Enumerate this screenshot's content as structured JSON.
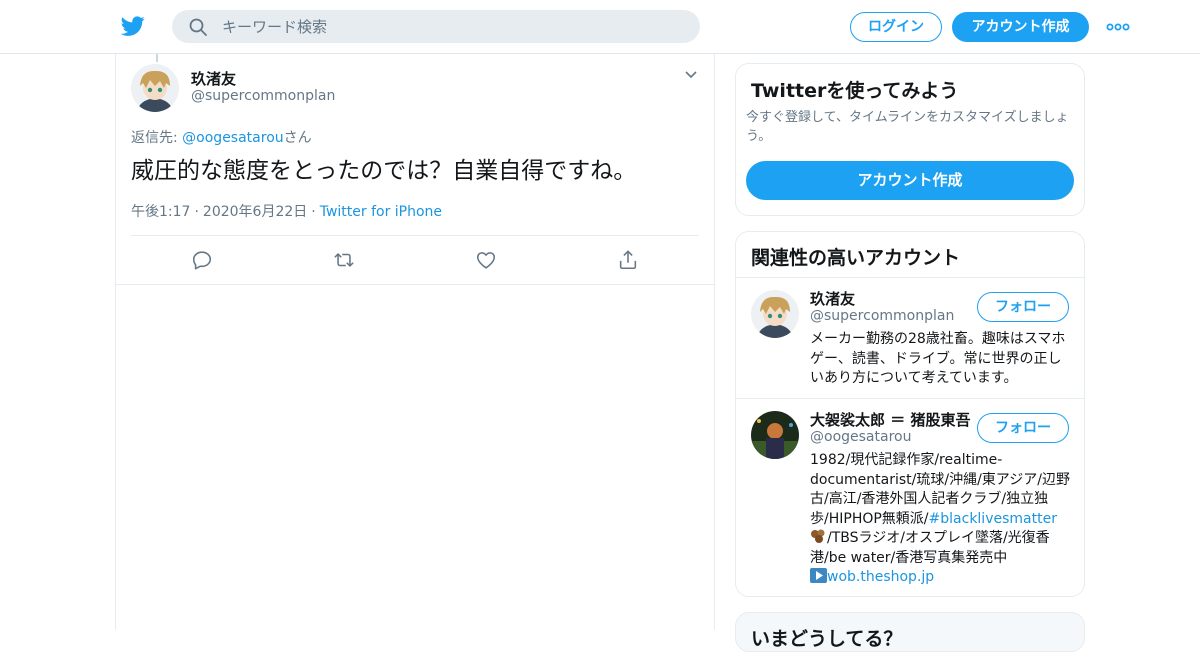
{
  "header": {
    "search_placeholder": "キーワード検索",
    "login_label": "ログイン",
    "signup_label": "アカウント作成",
    "brand_color": "#1da1f2"
  },
  "tweet": {
    "name": "玖渚友",
    "handle": "@supercommonplan",
    "reply_prefix": "返信先: ",
    "reply_mention": "@oogesatarou",
    "reply_suffix": "さん",
    "text": "威圧的な態度をとったのでは？自業自得ですね。",
    "time": "午後1:17",
    "date": "2020年6月22日",
    "source": "Twitter for iPhone",
    "separator": "·"
  },
  "sidebar": {
    "signup_card": {
      "title": "Twitterを使ってみよう",
      "description": "今すぐ登録して、タイムラインをカスタマイズしましょう。",
      "button_label": "アカウント作成"
    },
    "related": {
      "title": "関連性の高いアカウント",
      "accounts": [
        {
          "name": "玖渚友",
          "handle": "@supercommonplan",
          "follow_label": "フォロー",
          "bio": "メーカー勤務の28歳社畜。趣味はスマホゲー、読書、ドライブ。常に世界の正しいあり方について考えています。"
        },
        {
          "name": "大袈裟太郎 ＝ 猪股東吾",
          "handle": "@oogesatarou",
          "follow_label": "フォロー",
          "bio_part1": "1982/現代記録作家/realtime-documentarist/琉球/沖縄/東アジア/辺野古/高江/香港外国人記者クラブ/独立独歩/HIPHOP無頼派/",
          "bio_hashtag": "#blacklivesmatter",
          "bio_part2": "/TBSラジオ/オスプレイ墜落/光復香港/be water/香港写真集発売中",
          "bio_link": "wob.theshop.jp"
        }
      ]
    },
    "next_card": {
      "title": "いまどうしてる？"
    }
  }
}
